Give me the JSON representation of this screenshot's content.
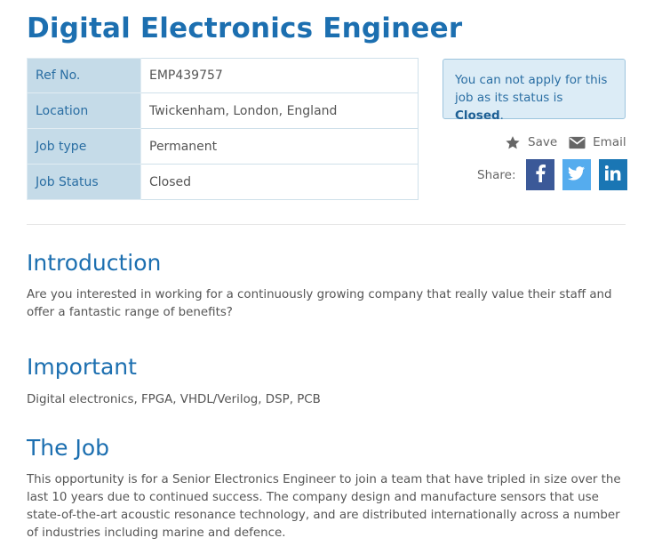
{
  "page_title": "Digital Electronics Engineer",
  "details": [
    {
      "key": "Ref No.",
      "value": "EMP439757"
    },
    {
      "key": "Location",
      "value": "Twickenham, London, England"
    },
    {
      "key": "Job type",
      "value": "Permanent"
    },
    {
      "key": "Job Status",
      "value": "Closed"
    }
  ],
  "status_notice": {
    "text": "You can not apply for this job as its status is ",
    "status": "Closed",
    "suffix": "."
  },
  "actions": {
    "save_label": "Save",
    "email_label": "Email",
    "share_label": "Share:"
  },
  "social": [
    {
      "icon": "facebook-icon",
      "glyph": "f",
      "color": "#3b5998"
    },
    {
      "icon": "twitter-icon",
      "glyph": "twitter-bird",
      "color": "#55acee"
    },
    {
      "icon": "linkedin-icon",
      "glyph": "in",
      "color": "#1a76b4"
    }
  ],
  "sections": {
    "introduction": {
      "title": "Introduction",
      "text": "Are you interested in working for a continuously growing company that really value their staff and offer a fantastic range of benefits?"
    },
    "important": {
      "title": "Important",
      "text": "Digital electronics, FPGA, VHDL/Verilog, DSP, PCB"
    },
    "the_job": {
      "title": "The Job",
      "text": "This opportunity is for a Senior Electronics Engineer to join a team that have tripled in size over the last 10 years due to continued success. The company design and manufacture sensors that use state-of-the-art acoustic resonance technology, and are distributed internationally across a number of industries including marine and defence."
    }
  },
  "colors": {
    "heading": "#1c6fb0",
    "table_key_bg": "#c5dbe8",
    "notice_bg": "#dcecf6",
    "facebook": "#3b5998",
    "twitter": "#55acee",
    "linkedin": "#1a76b4"
  }
}
